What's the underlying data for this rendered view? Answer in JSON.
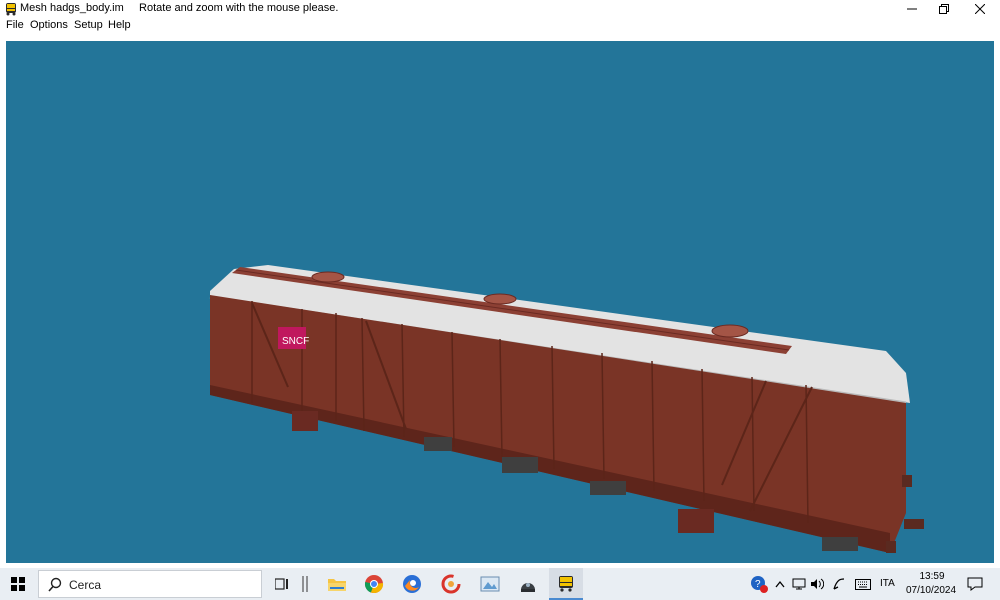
{
  "window": {
    "title": "Mesh hadgs_body.im",
    "hint": "Rotate and zoom with the mouse please.",
    "controls": [
      "minimize",
      "restore",
      "close"
    ]
  },
  "menu": {
    "items": [
      "File",
      "Options",
      "Setup",
      "Help"
    ]
  },
  "viewport": {
    "background": "#237599",
    "model": {
      "logo_text": "SNCF",
      "body_color": "#7a3426",
      "roof_color": "#e6e6e6",
      "logo_color": "#c0185e"
    }
  },
  "taskbar": {
    "search_placeholder": "Cerca",
    "apps": [
      "task-view",
      "file-explorer",
      "chrome",
      "firefox",
      "ccleaner",
      "image-viewer",
      "remote-desktop",
      "train-viewer"
    ],
    "tray": {
      "language": "ITA",
      "time": "13:59",
      "date": "07/10/2024"
    }
  }
}
